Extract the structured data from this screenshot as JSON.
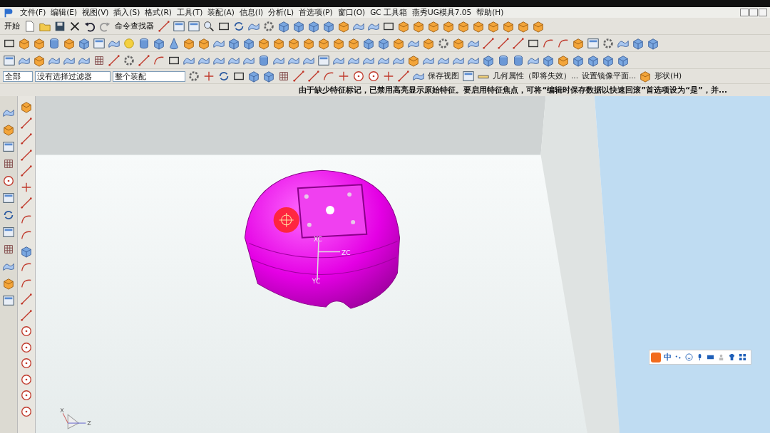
{
  "menu_bar": {
    "items": [
      "文件(F)",
      "编辑(E)",
      "视图(V)",
      "插入(S)",
      "格式(R)",
      "工具(T)",
      "装配(A)",
      "信息(I)",
      "分析(L)",
      "首选项(P)",
      "窗口(O)",
      "GC 工具箱",
      "燕秀UG模具7.05",
      "帮助(H)"
    ]
  },
  "standard_toolbar": {
    "start_button": "开始",
    "command_finder": "命令查找器"
  },
  "selection_bar": {
    "filter_scope": "全部",
    "type_filter": "没有选择过滤器",
    "assembly_scope": "整个装配",
    "save_view": "保存视图",
    "geometry_properties": "几何属性（即将失效）...",
    "mirror_plane": "设置镜像平面...",
    "shape_menu": "形状(H)"
  },
  "status_message": "由于缺少特征标记，已禁用高亮显示原始特征。要启用特征焦点，可将“编辑时保存数据以快速回滚”首选项设为“是”，并...",
  "viewport": {
    "axis_labels": [
      "XC",
      "ZC",
      "YC"
    ],
    "triad_labels": [
      "X",
      "Z"
    ]
  },
  "ime_bar": {
    "mode": "中"
  }
}
